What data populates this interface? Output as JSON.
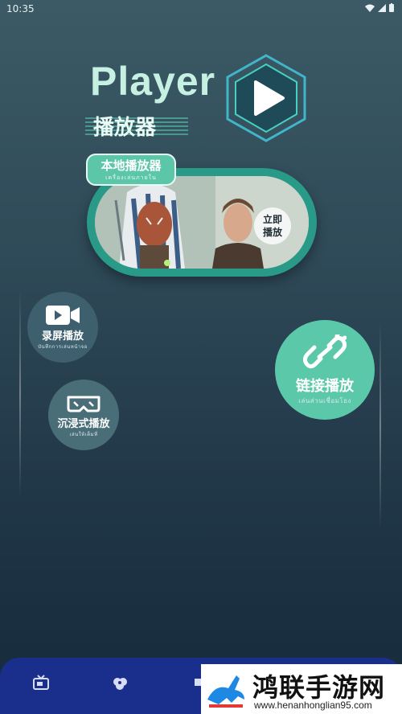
{
  "status_bar": {
    "time": "10:35"
  },
  "hero": {
    "title": "Player",
    "subtitle": "播放器"
  },
  "local_player": {
    "label": "本地播放器",
    "label_sub": "เครื่องเล่นภายใน",
    "play_now_line1": "立即",
    "play_now_line2": "播放"
  },
  "screen_record": {
    "label": "录屏播放",
    "sub": "บันทึกการเล่นหน้าจอ"
  },
  "link_play": {
    "label": "链接播放",
    "sub": "เล่นส่วนเชื่อมโยง"
  },
  "immersive": {
    "label": "沉浸式播放",
    "sub": "เล่นให้เต็มที่"
  },
  "watermark": {
    "title": "鸿联手游网",
    "url": "www.henanhonglian95.com"
  },
  "colors": {
    "accent": "#5bc9a9",
    "frame": "#2a9a88",
    "nav": "#1a2f8c"
  }
}
